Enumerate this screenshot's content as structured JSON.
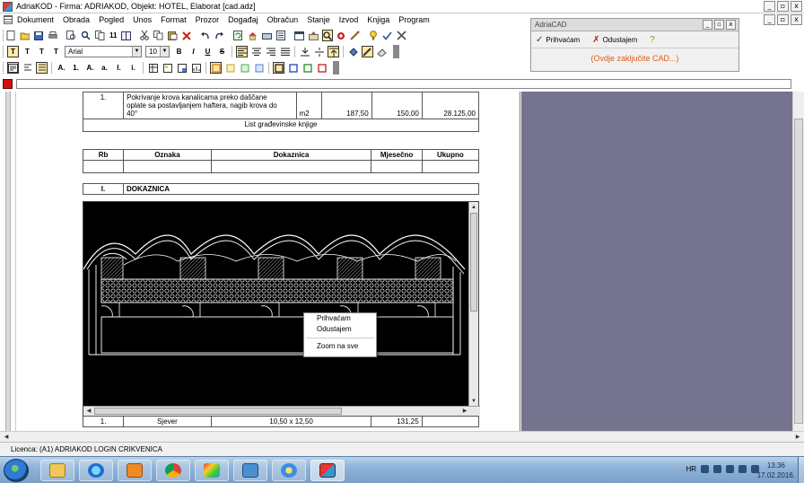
{
  "window": {
    "title": "AdriaKOD - Firma: ADRIAKOD,  Objekt: HOTEL, Elaborat [cad.adz]",
    "controls": [
      "_",
      "▫",
      "x"
    ]
  },
  "menu": {
    "items": [
      "Dokument",
      "Obrada",
      "Pogled",
      "Unos",
      "Format",
      "Prozor",
      "Događaj",
      "Obračun",
      "Stanje",
      "Izvod",
      "Knjiga",
      "Program"
    ]
  },
  "toolbar": {
    "font_name": "Arial",
    "font_size": "10",
    "t_buttons": [
      "T",
      "T",
      "T",
      "T"
    ],
    "style_buttons": [
      "B",
      "I",
      "U",
      "S"
    ],
    "list_buttons": [
      "A.",
      "1.",
      "A.",
      "a.",
      "I.",
      "i."
    ]
  },
  "adriacad": {
    "title": "AdriaCAD",
    "accept_label": "Prihvaćam",
    "cancel_label": "Odustajem",
    "message": "(Ovdje zaključite CAD...)"
  },
  "doc": {
    "item": {
      "rb": "1.",
      "desc": "Pokrivanje krova kanalicama preko daščane oplate sa postavljanjem haftera, nagib krova do 40°",
      "unit": "m2",
      "qty": "187,50",
      "price": "150,00",
      "total": "28.125,00"
    },
    "sheet_label": "List građevinske knjige",
    "headers": [
      "Rb",
      "Oznaka",
      "Dokaznica",
      "Mjesečno",
      "Ukupno"
    ],
    "section_no": "I.",
    "section_title": "DOKAZNICA",
    "bottom_row": {
      "rb": "1.",
      "oznaka": "Sjever",
      "dokaznica": "10,50 x 12,50",
      "mjesecno": "131,25",
      "ukupno": ""
    }
  },
  "context_menu": {
    "items": [
      "Prihvaćam",
      "Odustajem"
    ],
    "zoom": "Zoom na sve"
  },
  "status": {
    "licence": "Licenca: (A1) ADRIAKOD LOGIN CRIKVENICA"
  },
  "taskbar": {
    "language": "HR",
    "time": "13:36",
    "date": "17.02.2016."
  },
  "colors": {
    "purple_bg": "#76738f",
    "cad_bg": "#000000",
    "accent_orange": "#e35b16"
  }
}
